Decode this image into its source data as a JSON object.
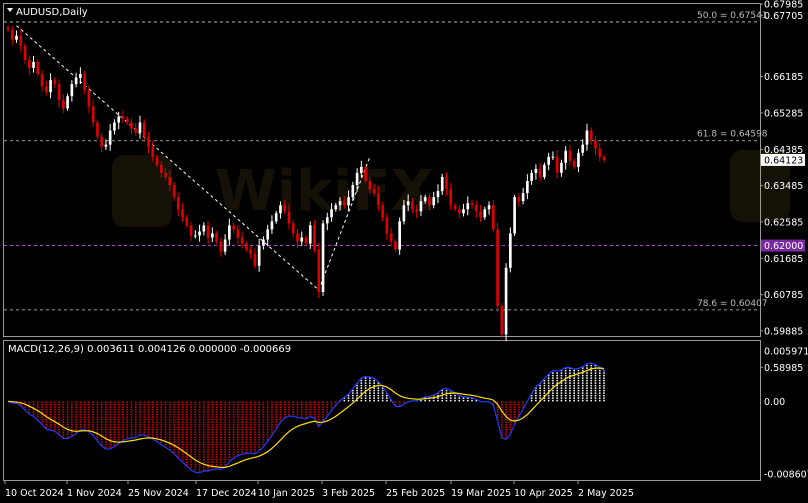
{
  "symbol_title": "AUDUSD,Daily",
  "chart_data": [
    {
      "type": "candlestick",
      "title": "AUDUSD,Daily",
      "ylim": [
        0.5976,
        0.67985
      ],
      "y_ticks": [
        "0.67985",
        "0.67705",
        "0.66185",
        "0.65285",
        "0.64385",
        "0.63485",
        "0.62585",
        "0.61685",
        "0.60785",
        "0.59885",
        "0.58985"
      ],
      "x_ticks": [
        "10 Oct 2024",
        "1 Nov 2024",
        "25 Nov 2024",
        "17 Dec 2024",
        "10 Jan 2025",
        "3 Feb 2025",
        "25 Feb 2025",
        "19 Mar 2025",
        "10 Apr 2025",
        "2 May 2025"
      ],
      "current_price": "0.64123",
      "colors": {
        "up": "#ffffff",
        "down": "#e00000",
        "level": "#c8c8c8",
        "marker": "#c050e0"
      },
      "fib_levels": [
        {
          "label": "50.0 = 0.67541",
          "value": 0.67541
        },
        {
          "label": "61.8 = 0.64598",
          "value": 0.64598
        },
        {
          "label": "78.6 = 0.60407",
          "value": 0.60407
        }
      ],
      "marker_level": {
        "label": "0.62000",
        "value": 0.62
      },
      "trend_lines": [
        {
          "from": {
            "x": "Oct 2024",
            "y": 0.6745
          },
          "to": {
            "x": "3 Feb 2025",
            "y": 0.609
          }
        },
        {
          "from": {
            "x": "3 Feb 2025",
            "y": 0.609
          },
          "to": {
            "x": "Feb 2025",
            "y": 0.642
          }
        }
      ],
      "closes": [
        0.6735,
        0.671,
        0.672,
        0.6695,
        0.666,
        0.664,
        0.6655,
        0.6625,
        0.6595,
        0.658,
        0.661,
        0.66,
        0.656,
        0.654,
        0.657,
        0.66,
        0.6615,
        0.6625,
        0.6585,
        0.6545,
        0.6505,
        0.647,
        0.6445,
        0.645,
        0.6485,
        0.6505,
        0.652,
        0.6515,
        0.6505,
        0.649,
        0.648,
        0.6505,
        0.647,
        0.6445,
        0.642,
        0.64,
        0.638,
        0.637,
        0.635,
        0.632,
        0.629,
        0.627,
        0.625,
        0.6225,
        0.6225,
        0.6235,
        0.625,
        0.622,
        0.623,
        0.621,
        0.6185,
        0.6215,
        0.625,
        0.624,
        0.622,
        0.6205,
        0.619,
        0.618,
        0.615,
        0.62,
        0.6215,
        0.624,
        0.626,
        0.628,
        0.63,
        0.6285,
        0.6255,
        0.623,
        0.621,
        0.622,
        0.6205,
        0.625,
        0.619,
        0.6085,
        0.6255,
        0.627,
        0.629,
        0.63,
        0.631,
        0.63,
        0.632,
        0.635,
        0.638,
        0.6395,
        0.636,
        0.634,
        0.633,
        0.63,
        0.627,
        0.623,
        0.621,
        0.619,
        0.626,
        0.63,
        0.631,
        0.629,
        0.6285,
        0.631,
        0.632,
        0.63,
        0.632,
        0.6335,
        0.637,
        0.634,
        0.63,
        0.629,
        0.628,
        0.629,
        0.6305,
        0.63,
        0.6285,
        0.627,
        0.629,
        0.63,
        0.624,
        0.605,
        0.598,
        0.6145,
        0.623,
        0.632,
        0.631,
        0.633,
        0.636,
        0.638,
        0.639,
        0.637,
        0.64,
        0.642,
        0.642,
        0.638,
        0.6405,
        0.6435,
        0.641,
        0.6395,
        0.643,
        0.645,
        0.6485,
        0.646,
        0.644,
        0.642,
        0.6412
      ]
    },
    {
      "type": "macd",
      "title": "MACD(12,26,9) 0.003611 0.004126 0.000000 -0.000669",
      "params": [
        12,
        26,
        9
      ],
      "values": {
        "main": 0.003611,
        "signal": 0.004126,
        "histogram_up": 0.0,
        "histogram_down": -0.000669
      },
      "ylim": [
        -0.008607,
        0.005971
      ],
      "y_ticks": [
        "0.005971",
        "0.00",
        "-0.008607"
      ],
      "colors": {
        "main": "#1e3cff",
        "signal": "#ffe000",
        "hist_up": "#ffffff",
        "hist_down": "#e00000"
      }
    }
  ]
}
